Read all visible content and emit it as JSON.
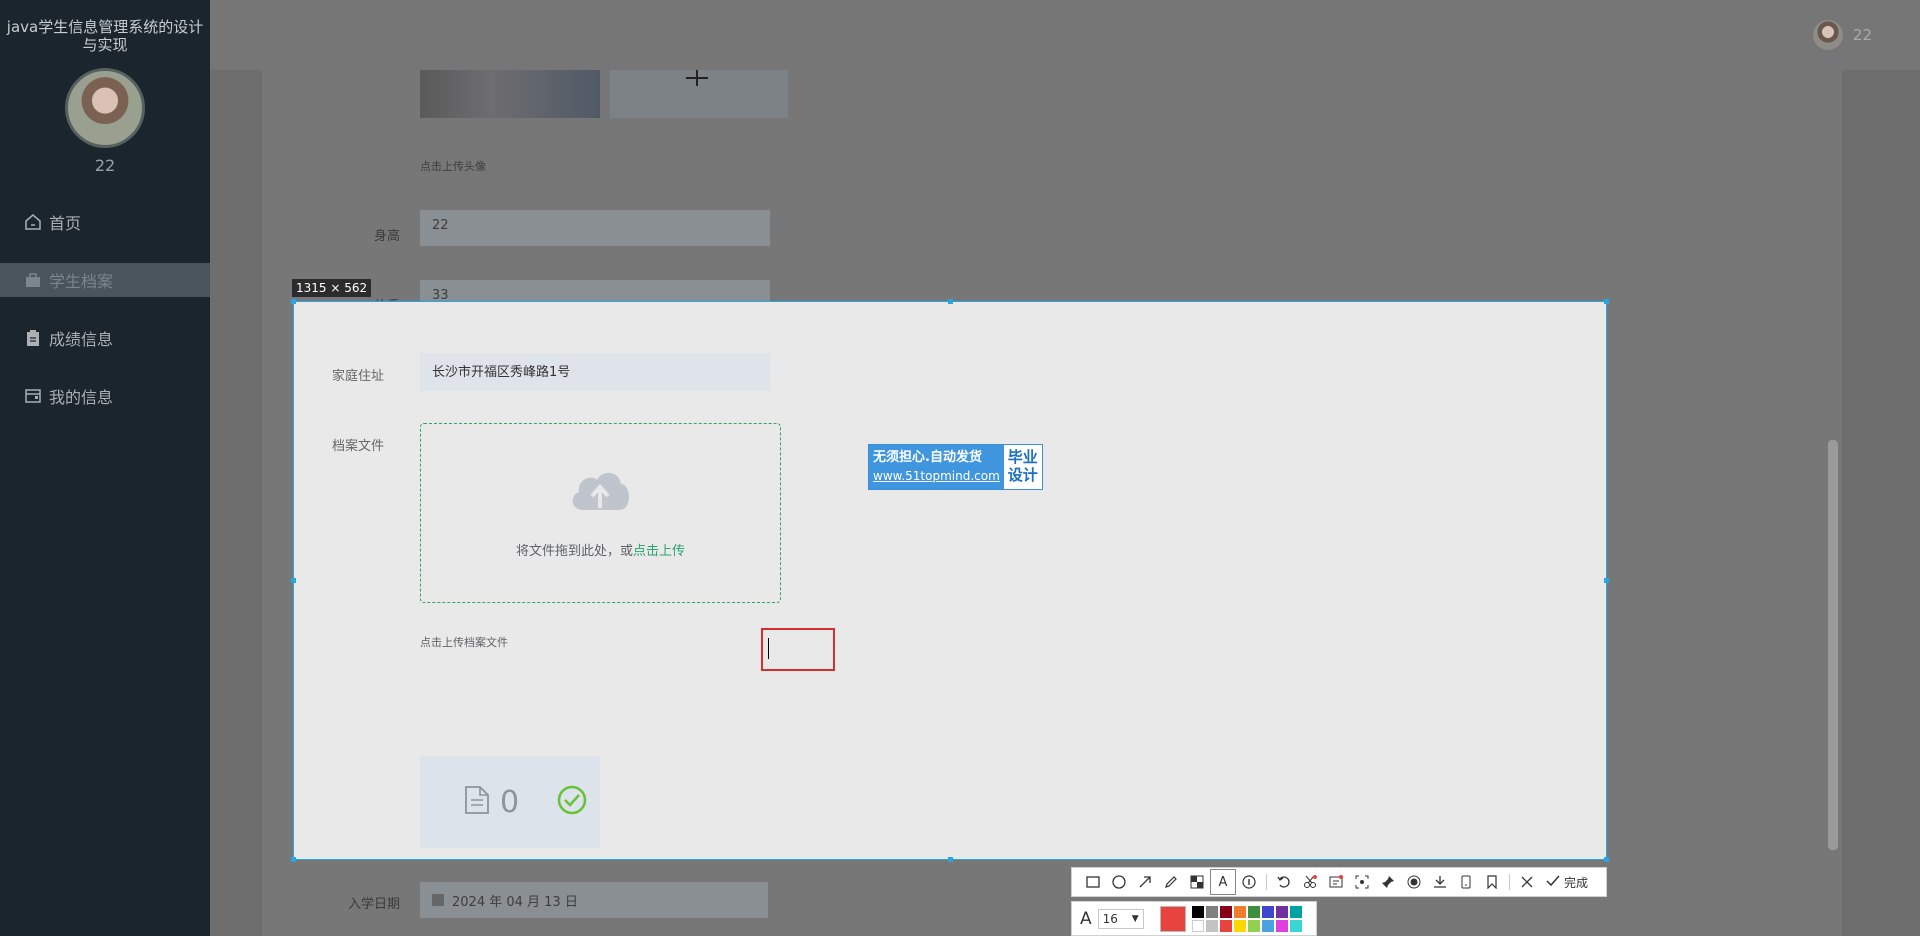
{
  "app": {
    "title": "java学生信息管理系统的设计与实现",
    "username": "22"
  },
  "sidebar": {
    "items": [
      {
        "label": "首页",
        "icon": "home-icon"
      },
      {
        "label": "学生档案",
        "icon": "briefcase-icon",
        "active": true
      },
      {
        "label": "成绩信息",
        "icon": "clipboard-icon"
      },
      {
        "label": "我的信息",
        "icon": "wallet-icon"
      }
    ]
  },
  "form": {
    "avatar_hint": "点击上传头像",
    "height_label": "身高",
    "height_value": "22",
    "weight_label": "体重",
    "weight_value": "33",
    "address_label": "家庭住址",
    "address_value": "长沙市开福区秀峰路1号",
    "file_label": "档案文件",
    "upload_text": "将文件拖到此处，或",
    "upload_link": "点击上传",
    "file_hint": "点击上传档案文件",
    "file_count": "0",
    "enroll_label": "入学日期",
    "enroll_value": "2024 年 04 月 13 日"
  },
  "banner": {
    "line1": "无须担心.自动发货",
    "line2": "www.51topmind.com",
    "right": "毕业\n设计"
  },
  "capture": {
    "size_label": "1315 × 562",
    "font_size": "16",
    "done_label": "完成",
    "current_color": "#e8433f",
    "palette": [
      "#000000",
      "#7f7f7f",
      "#880015",
      "#ed7d31",
      "#3c8f3c",
      "#3f48cc",
      "#7030a0",
      "#00a2a2",
      "#ffffff",
      "#c3c3c3",
      "#e8433f",
      "#ffd700",
      "#92d050",
      "#4aa3df",
      "#e040e0",
      "#3ad6d6"
    ],
    "tools": [
      "rect-tool-icon",
      "ellipse-tool-icon",
      "arrow-tool-icon",
      "pencil-tool-icon",
      "mosaic-tool-icon",
      "text-tool-icon",
      "number-tool-icon",
      "undo-icon",
      "cut-icon",
      "ocr-icon",
      "scroll-capture-icon",
      "pin-icon",
      "record-icon",
      "download-icon",
      "long-capture-icon",
      "bookmark-icon"
    ]
  }
}
